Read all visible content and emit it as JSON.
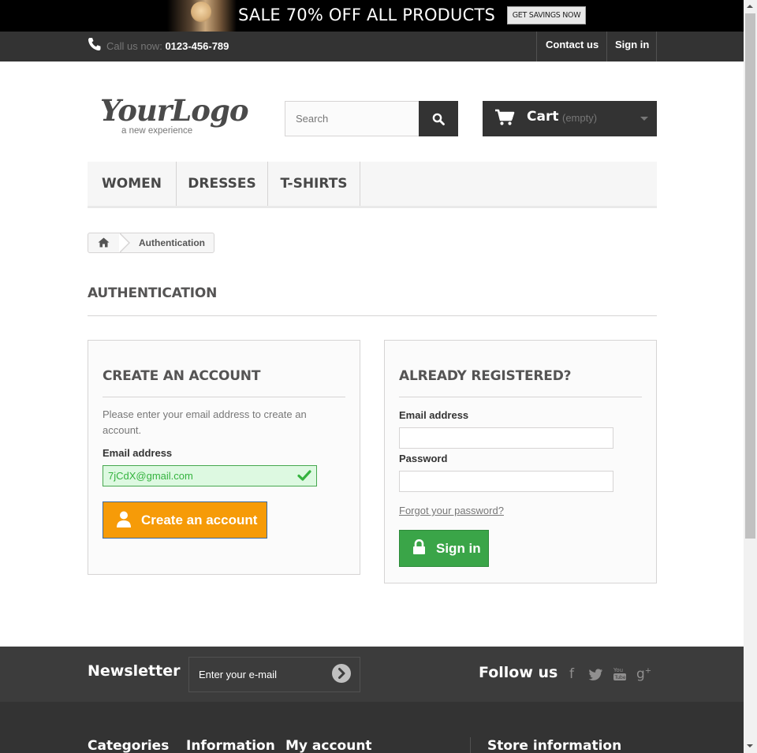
{
  "banner": {
    "text": "SALE 70% OFF ALL PRODUCTS",
    "button": "GET SAVINGS NOW"
  },
  "topnav": {
    "call_label": "Call us now:",
    "phone": "0123-456-789",
    "contact": "Contact us",
    "signin": "Sign in"
  },
  "header": {
    "logo_main": "YourLogo",
    "logo_tagline": "a new experience",
    "search_placeholder": "Search",
    "cart_label": "Cart",
    "cart_status": "(empty)"
  },
  "menu": {
    "items": [
      "WOMEN",
      "DRESSES",
      "T-SHIRTS"
    ]
  },
  "breadcrumb": {
    "current": "Authentication"
  },
  "page": {
    "heading": "AUTHENTICATION"
  },
  "create_account": {
    "title": "CREATE AN ACCOUNT",
    "instructions": "Please enter your email address to create an account.",
    "email_label": "Email address",
    "email_value": "7jCdX@gmail.com",
    "button": "Create an account"
  },
  "registered": {
    "title": "ALREADY REGISTERED?",
    "email_label": "Email address",
    "email_value": "",
    "password_label": "Password",
    "password_value": "",
    "forgot": "Forgot your password?",
    "button": "Sign in"
  },
  "footer": {
    "newsletter_title": "Newsletter",
    "newsletter_placeholder": "Enter your e-mail",
    "follow_title": "Follow us",
    "social_icons": [
      "facebook-icon",
      "twitter-icon",
      "youtube-icon",
      "google-plus-icon"
    ],
    "columns": [
      "Categories",
      "Information",
      "My account",
      "Store information"
    ]
  },
  "colors": {
    "dark": "#333333",
    "create_button": "#f69b08",
    "signin_button": "#3aa548",
    "valid_field_bg": "#ddf9e1",
    "valid_field_text": "#35b33f"
  }
}
